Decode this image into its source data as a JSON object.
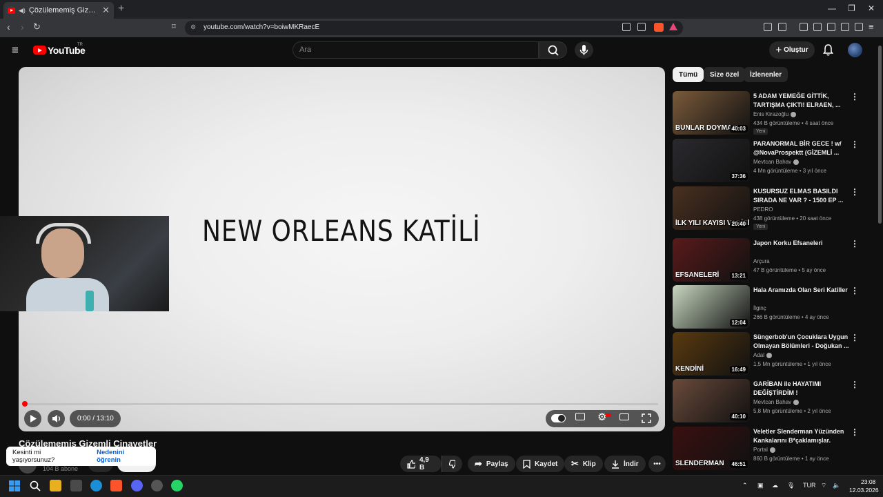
{
  "browser": {
    "tab_title": "Çözülememiş Gizemli Cinayetler",
    "tab_close": "✕",
    "new_tab": "+",
    "url": "youtube.com/watch?v=boiwMKRaecE"
  },
  "youtube": {
    "logo_text": "YouTube",
    "region": "TR",
    "search_placeholder": "Ara",
    "create_label": "Oluştur",
    "create_plus": "+"
  },
  "player": {
    "title_card_text": "NEW ORLEANS KATİLİ",
    "time_display": "0:00 / 13:10",
    "progress_fraction": 0.0
  },
  "video": {
    "title": "Çözülememiş Gizemli Cinayetler",
    "subscribers": "104 B abone"
  },
  "toast": {
    "question": "Kesinti mi yaşıyorsunuz?",
    "link": "Nedenini öğrenin"
  },
  "actions": {
    "like_count": "4,9 B",
    "share": "Paylaş",
    "save": "Kaydet",
    "clip": "Klip",
    "download": "İndir"
  },
  "chips": [
    "Tümü",
    "Size özel",
    "İzlenenler"
  ],
  "recommendations": [
    {
      "title": "5 ADAM YEMEĞE GİTTİK, TARTIŞMA ÇIKTI! ELRAEN, ...",
      "channel": "Enis Kirazoğlu",
      "verified": true,
      "meta": "434 B görüntüleme • 4 saat önce",
      "badge": "Yeni",
      "duration": "40:03",
      "thumb_text": "BUNLAR DOYMAZ!",
      "thumb_color": "#7a5a3a"
    },
    {
      "title": "PARANORMAL BİR GECE ! w/ @NovaProspektt (GİZEMLİ ...",
      "channel": "Mevtcan Bahav",
      "verified": true,
      "meta": "4 Mn görüntüleme • 3 yıl önce",
      "badge": "",
      "duration": "37:36",
      "thumb_text": "",
      "thumb_color": "#2a2a2e"
    },
    {
      "title": "KUSURSUZ ELMAS BASILDI SIRADA NE VAR ? - 1500 EP ...",
      "channel": "PEDRO",
      "verified": false,
      "meta": "438 görüntüleme • 20 saat önce",
      "badge": "Yeni",
      "duration": "20:40",
      "thumb_text": "İLK YILI KAYISI VADİSİ",
      "thumb_color": "#4a3020"
    },
    {
      "title": "Japon Korku Efsaneleri",
      "channel": "Arçura",
      "verified": false,
      "meta": "47 B görüntüleme • 5 ay önce",
      "badge": "",
      "duration": "13:21",
      "thumb_text": "EFSANELERİ",
      "thumb_color": "#5a1a1a"
    },
    {
      "title": "Hala Aramızda Olan Seri Katiller",
      "channel": "İlginç",
      "verified": false,
      "meta": "266 B görüntüleme • 4 ay önce",
      "badge": "",
      "duration": "12:04",
      "thumb_text": "",
      "thumb_color": "#c8d8c0"
    },
    {
      "title": "Süngerbob'un Çocuklara Uygun Olmayan Bölümleri - Doğukan ...",
      "channel": "Adal",
      "verified": true,
      "meta": "1,5 Mn görüntüleme • 1 yıl önce",
      "badge": "",
      "duration": "16:49",
      "thumb_text": "KENDİNİ",
      "thumb_color": "#5a3a10"
    },
    {
      "title": "GARİBAN ile HAYATIMI DEĞİŞTİRDİM !",
      "channel": "Mevtcan Bahav",
      "verified": true,
      "meta": "5,8 Mn görüntüleme • 2 yıl önce",
      "badge": "",
      "duration": "40:10",
      "thumb_text": "",
      "thumb_color": "#6a4a3a"
    },
    {
      "title": "Veletler Slenderman Yüzünden Kankalarını B*çaklamışlar.",
      "channel": "Portal",
      "verified": true,
      "meta": "860 B görüntüleme • 1 ay önce",
      "badge": "",
      "duration": "46:51",
      "thumb_text": "SLENDERMAN",
      "thumb_color": "#3a1010"
    }
  ],
  "taskbar": {
    "language": "TUR",
    "time": "23:08",
    "date": "12.03.2026"
  }
}
